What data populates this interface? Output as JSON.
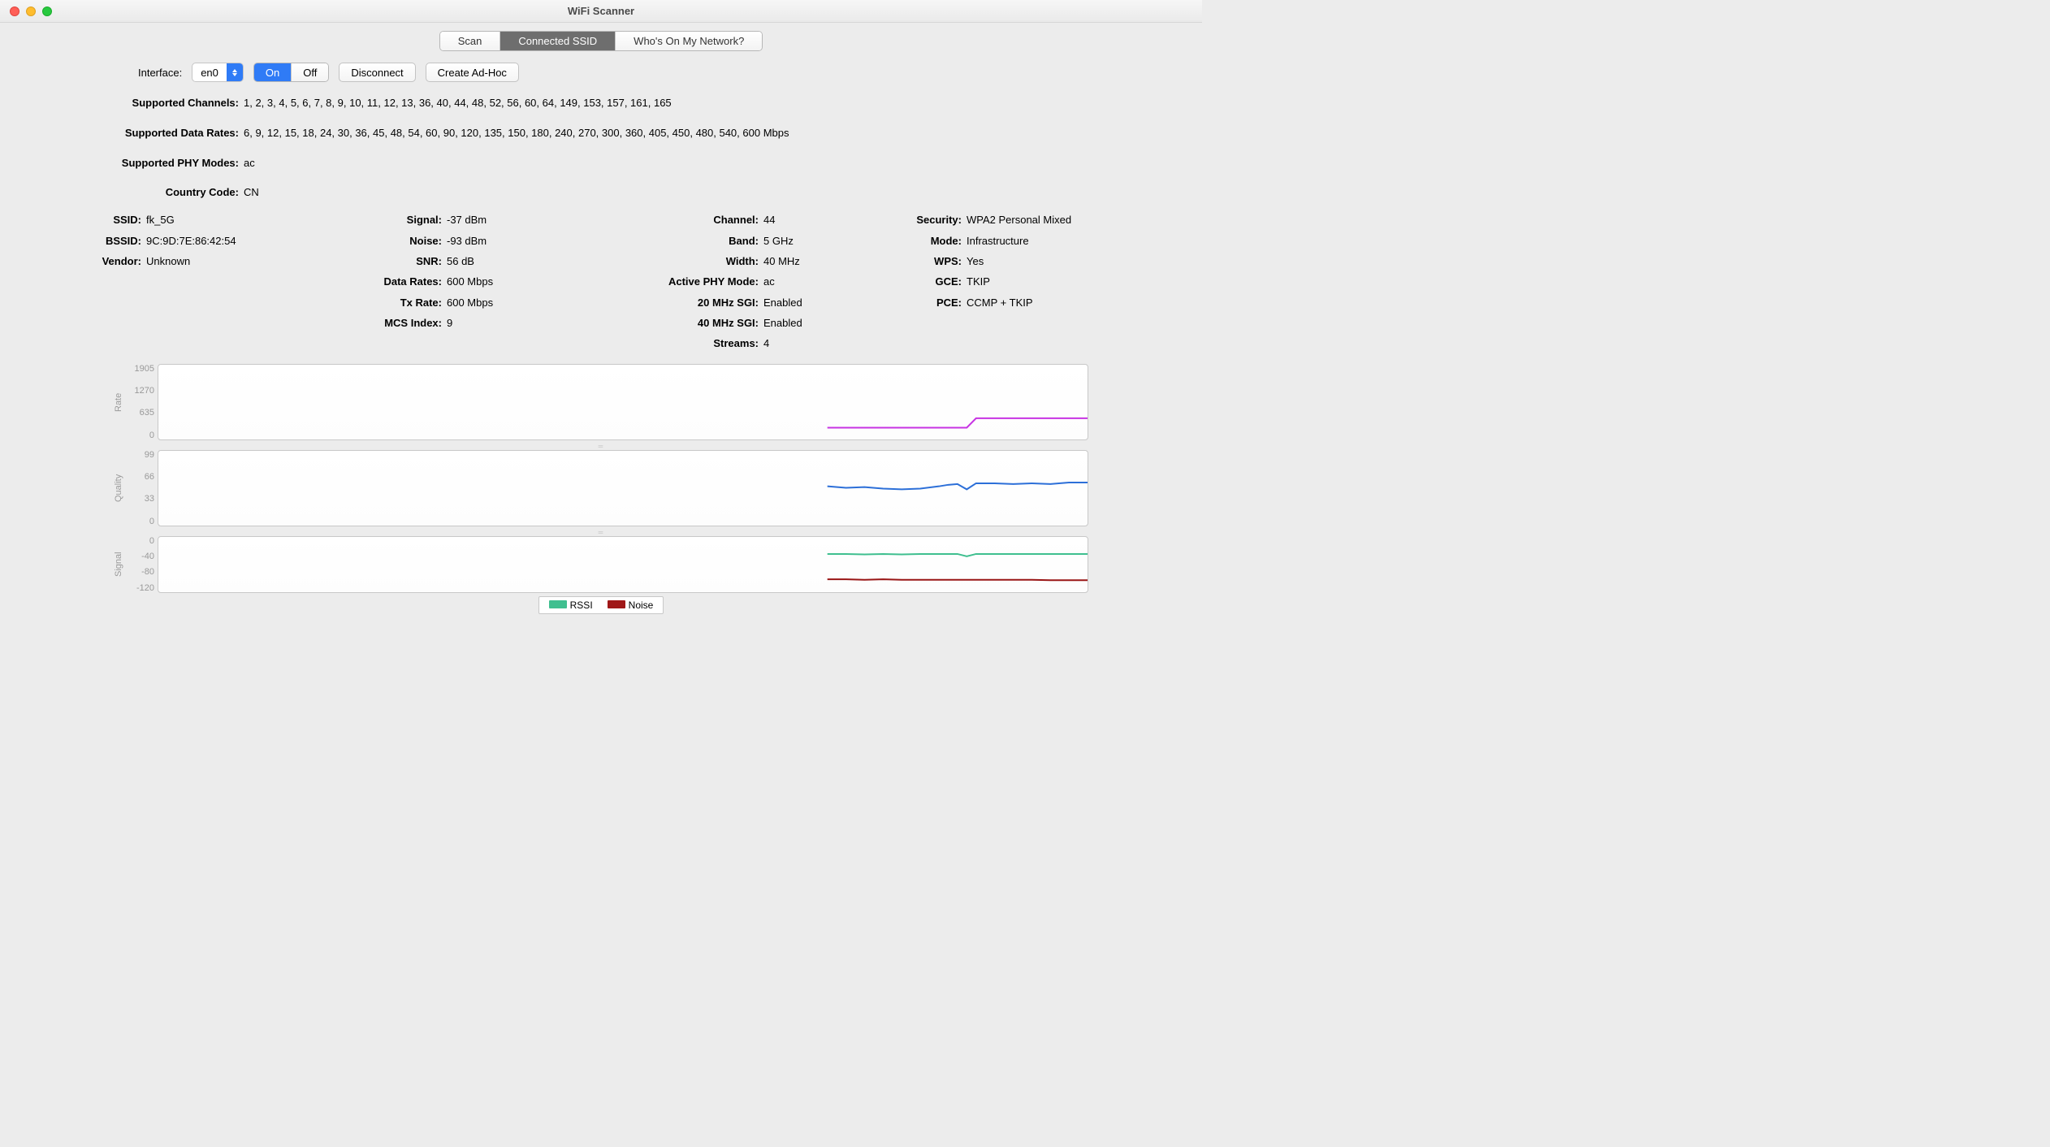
{
  "window": {
    "title": "WiFi Scanner"
  },
  "tabs": {
    "scan": "Scan",
    "connected": "Connected SSID",
    "whos_on": "Who's On My Network?",
    "active": "connected"
  },
  "controls": {
    "interface_label": "Interface:",
    "interface_value": "en0",
    "on": "On",
    "off": "Off",
    "power_state": "on",
    "disconnect": "Disconnect",
    "create_adhoc": "Create Ad-Hoc"
  },
  "caps": {
    "supported_channels_label": "Supported Channels:",
    "supported_channels": "1, 2, 3, 4, 5, 6, 7, 8, 9, 10, 11, 12, 13, 36, 40, 44, 48, 52, 56, 60, 64, 149, 153, 157, 161, 165",
    "supported_data_rates_label": "Supported Data Rates:",
    "supported_data_rates": "6, 9, 12, 15, 18, 24, 30, 36, 45, 48, 54, 60, 90, 120, 135, 150, 180, 240, 270, 300, 360, 405, 450, 480, 540, 600 Mbps",
    "supported_phy_modes_label": "Supported PHY Modes:",
    "supported_phy_modes": "ac",
    "country_code_label": "Country Code:",
    "country_code": "CN"
  },
  "col1": {
    "ssid_l": "SSID:",
    "ssid": "fk_5G",
    "bssid_l": "BSSID:",
    "bssid": "9C:9D:7E:86:42:54",
    "vendor_l": "Vendor:",
    "vendor": "Unknown"
  },
  "col2": {
    "signal_l": "Signal:",
    "signal": "-37 dBm",
    "noise_l": "Noise:",
    "noise": "-93 dBm",
    "snr_l": "SNR:",
    "snr": "56 dB",
    "data_rates_l": "Data Rates:",
    "data_rates": "600 Mbps",
    "tx_rate_l": "Tx Rate:",
    "tx_rate": "600 Mbps",
    "mcs_l": "MCS Index:",
    "mcs": "9"
  },
  "col3": {
    "channel_l": "Channel:",
    "channel": "44",
    "band_l": "Band:",
    "band": "5 GHz",
    "width_l": "Width:",
    "width": "40 MHz",
    "active_phy_l": "Active PHY Mode:",
    "active_phy": "ac",
    "sgi20_l": "20 MHz SGI:",
    "sgi20": "Enabled",
    "sgi40_l": "40 MHz SGI:",
    "sgi40": "Enabled",
    "streams_l": "Streams:",
    "streams": "4"
  },
  "col4": {
    "security_l": "Security:",
    "security": "WPA2 Personal Mixed",
    "mode_l": "Mode:",
    "mode": "Infrastructure",
    "wps_l": "WPS:",
    "wps": "Yes",
    "gce_l": "GCE:",
    "gce": "TKIP",
    "pce_l": "PCE:",
    "pce": "CCMP + TKIP"
  },
  "chart_data": [
    {
      "type": "line",
      "title": "Rate",
      "ylabel": "Rate",
      "ylim": [
        0,
        1905
      ],
      "yticks": [
        0,
        635,
        1270,
        1905
      ],
      "series": [
        {
          "name": "Rate",
          "color": "#c734e3",
          "x": [
            0.72,
            0.74,
            0.76,
            0.78,
            0.8,
            0.82,
            0.84,
            0.86,
            0.87,
            0.88,
            0.9,
            0.92,
            0.94,
            0.96,
            0.98,
            1.0
          ],
          "values": [
            300,
            300,
            300,
            300,
            300,
            300,
            300,
            300,
            300,
            540,
            540,
            540,
            540,
            540,
            540,
            540
          ]
        }
      ]
    },
    {
      "type": "line",
      "title": "Quality",
      "ylabel": "Quality",
      "ylim": [
        0,
        99
      ],
      "yticks": [
        0,
        33,
        66,
        99
      ],
      "series": [
        {
          "name": "Quality",
          "color": "#2c6fd8",
          "x": [
            0.72,
            0.74,
            0.76,
            0.78,
            0.8,
            0.82,
            0.84,
            0.85,
            0.86,
            0.87,
            0.88,
            0.9,
            0.92,
            0.94,
            0.96,
            0.98,
            1.0
          ],
          "values": [
            52,
            50,
            51,
            49,
            48,
            49,
            52,
            54,
            55,
            48,
            56,
            56,
            55,
            56,
            55,
            57,
            57
          ]
        }
      ]
    },
    {
      "type": "line",
      "title": "Signal",
      "ylabel": "Signal",
      "ylim": [
        -120,
        0
      ],
      "yticks": [
        -120,
        -80,
        -40,
        0
      ],
      "series": [
        {
          "name": "RSSI",
          "color": "#3fbf8f",
          "x": [
            0.72,
            0.74,
            0.76,
            0.78,
            0.8,
            0.82,
            0.84,
            0.86,
            0.87,
            0.88,
            0.9,
            0.92,
            0.94,
            0.96,
            0.98,
            1.0
          ],
          "values": [
            -37,
            -37,
            -38,
            -37,
            -38,
            -37,
            -37,
            -37,
            -42,
            -37,
            -37,
            -37,
            -37,
            -37,
            -37,
            -37
          ]
        },
        {
          "name": "Noise",
          "color": "#991515",
          "x": [
            0.72,
            0.74,
            0.76,
            0.78,
            0.8,
            0.82,
            0.84,
            0.86,
            0.88,
            0.9,
            0.92,
            0.94,
            0.96,
            0.98,
            1.0
          ],
          "values": [
            -92,
            -92,
            -93,
            -92,
            -93,
            -93,
            -93,
            -93,
            -93,
            -93,
            -93,
            -93,
            -94,
            -94,
            -94
          ]
        }
      ]
    }
  ],
  "legend": {
    "rssi": "RSSI",
    "noise": "Noise"
  }
}
